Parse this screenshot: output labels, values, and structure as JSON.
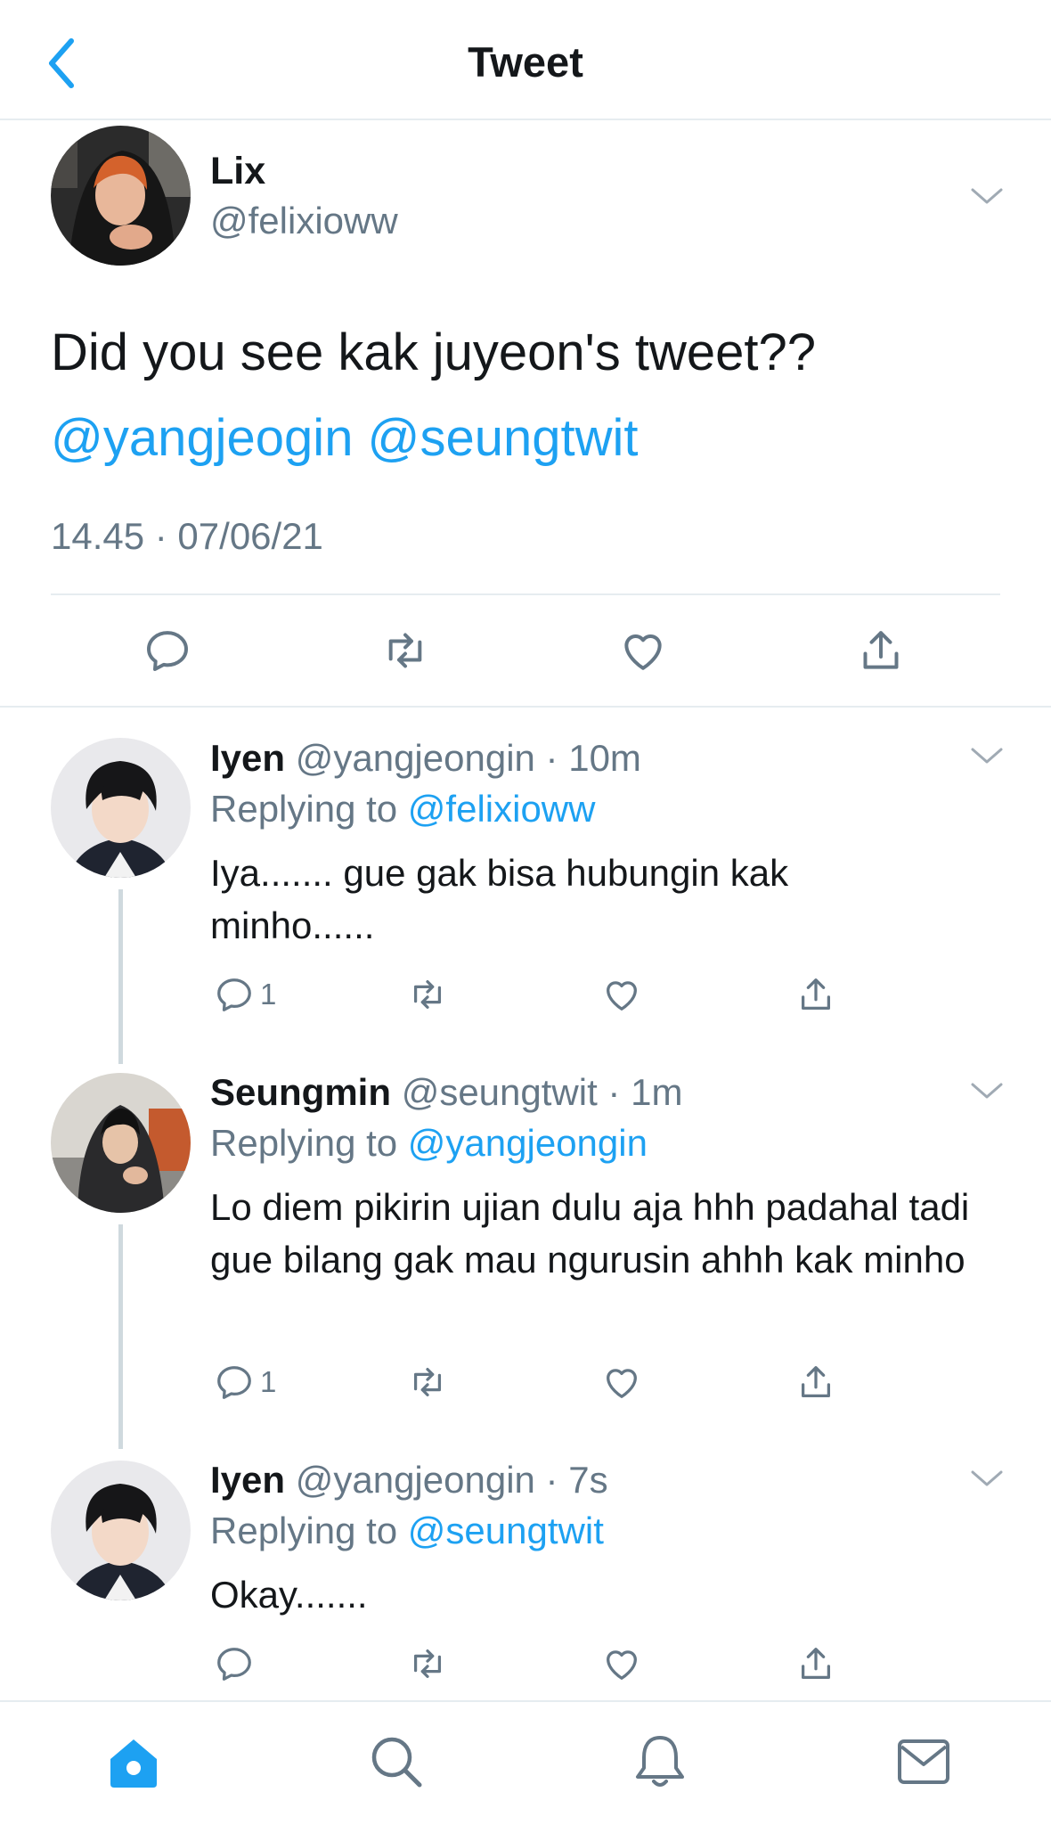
{
  "header": {
    "title": "Tweet"
  },
  "main_tweet": {
    "name": "Lix",
    "handle": "@felixioww",
    "text": "Did you see kak juyeon's tweet??",
    "mentions": "@yangjeogin @seungtwit",
    "timestamp": "14.45 · 07/06/21"
  },
  "replies": [
    {
      "name": "Iyen",
      "meta": "@yangjeongin · 10m",
      "replying_label": "Replying to ",
      "replying_to": "@felixioww",
      "text": "Iya....... gue gak bisa hubungin kak minho......",
      "reply_count": "1"
    },
    {
      "name": "Seungmin",
      "meta": "@seungtwit · 1m",
      "replying_label": "Replying to ",
      "replying_to": "@yangjeongin",
      "text": "Lo diem pikirin ujian dulu aja hhh padahal tadi gue bilang gak mau ngurusin ahhh kak minho",
      "reply_count": "1"
    },
    {
      "name": "Iyen",
      "meta": "@yangjeongin · 7s",
      "replying_label": "Replying to ",
      "replying_to": "@seungtwit",
      "text": "Okay.......",
      "reply_count": ""
    }
  ],
  "icons": {
    "back": "chevron-left-icon",
    "menu": "chevron-down-icon",
    "reply": "comment-icon",
    "retweet": "retweet-icon",
    "like": "heart-icon",
    "share": "share-icon",
    "tabs": [
      "home-icon",
      "search-icon",
      "bell-icon",
      "mail-icon"
    ]
  },
  "colors": {
    "accent": "#1da1f2",
    "secondary": "#657786",
    "border": "#e6ecf0"
  }
}
